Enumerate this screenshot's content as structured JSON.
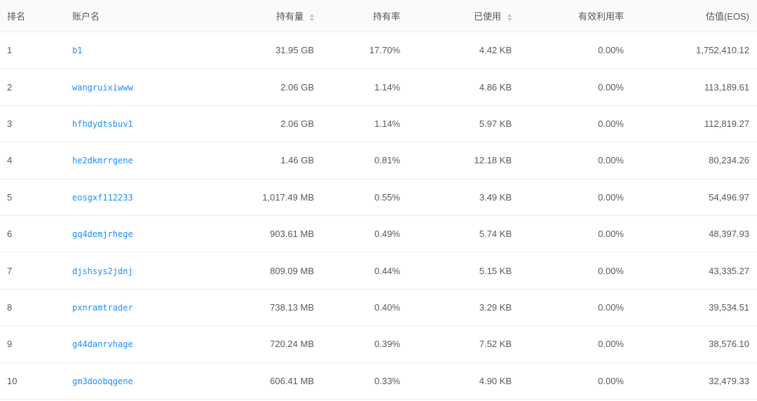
{
  "headers": {
    "rank": "排名",
    "account": "账户名",
    "holding": "持有量",
    "holding_rate": "持有率",
    "used": "已使用",
    "effective_rate": "有效利用率",
    "valuation": "估值(EOS)"
  },
  "rows": [
    {
      "rank": "1",
      "account": "b1",
      "holding": "31.95 GB",
      "holding_rate": "17.70%",
      "used": "4.42 KB",
      "effective_rate": "0.00%",
      "valuation": "1,752,410.12"
    },
    {
      "rank": "2",
      "account": "wangruixiwww",
      "holding": "2.06 GB",
      "holding_rate": "1.14%",
      "used": "4.86 KB",
      "effective_rate": "0.00%",
      "valuation": "113,189.61"
    },
    {
      "rank": "3",
      "account": "hfhdydtsbuv1",
      "holding": "2.06 GB",
      "holding_rate": "1.14%",
      "used": "5.97 KB",
      "effective_rate": "0.00%",
      "valuation": "112,819.27"
    },
    {
      "rank": "4",
      "account": "he2dkmrrgene",
      "holding": "1.46 GB",
      "holding_rate": "0.81%",
      "used": "12.18 KB",
      "effective_rate": "0.00%",
      "valuation": "80,234.26"
    },
    {
      "rank": "5",
      "account": "eosgxf112233",
      "holding": "1,017.49 MB",
      "holding_rate": "0.55%",
      "used": "3.49 KB",
      "effective_rate": "0.00%",
      "valuation": "54,496.97"
    },
    {
      "rank": "6",
      "account": "gq4demjrhege",
      "holding": "903.61 MB",
      "holding_rate": "0.49%",
      "used": "5.74 KB",
      "effective_rate": "0.00%",
      "valuation": "48,397.93"
    },
    {
      "rank": "7",
      "account": "djshsys2jdnj",
      "holding": "809.09 MB",
      "holding_rate": "0.44%",
      "used": "5.15 KB",
      "effective_rate": "0.00%",
      "valuation": "43,335.27"
    },
    {
      "rank": "8",
      "account": "pxnramtrader",
      "holding": "738.13 MB",
      "holding_rate": "0.40%",
      "used": "3.29 KB",
      "effective_rate": "0.00%",
      "valuation": "39,534.51"
    },
    {
      "rank": "9",
      "account": "g44danrvhage",
      "holding": "720.24 MB",
      "holding_rate": "0.39%",
      "used": "7.52 KB",
      "effective_rate": "0.00%",
      "valuation": "38,576.10"
    },
    {
      "rank": "10",
      "account": "gm3doobqgene",
      "holding": "606.41 MB",
      "holding_rate": "0.33%",
      "used": "4.90 KB",
      "effective_rate": "0.00%",
      "valuation": "32,479.33"
    }
  ],
  "colors": {
    "link": "#1890ff",
    "text": "#595959",
    "header_bg": "#fafafa",
    "border": "#ececec",
    "sort_icon": "#bfbfbf"
  },
  "icons": {
    "holding_sort": "sort-icon",
    "used_sort": "sort-icon"
  }
}
